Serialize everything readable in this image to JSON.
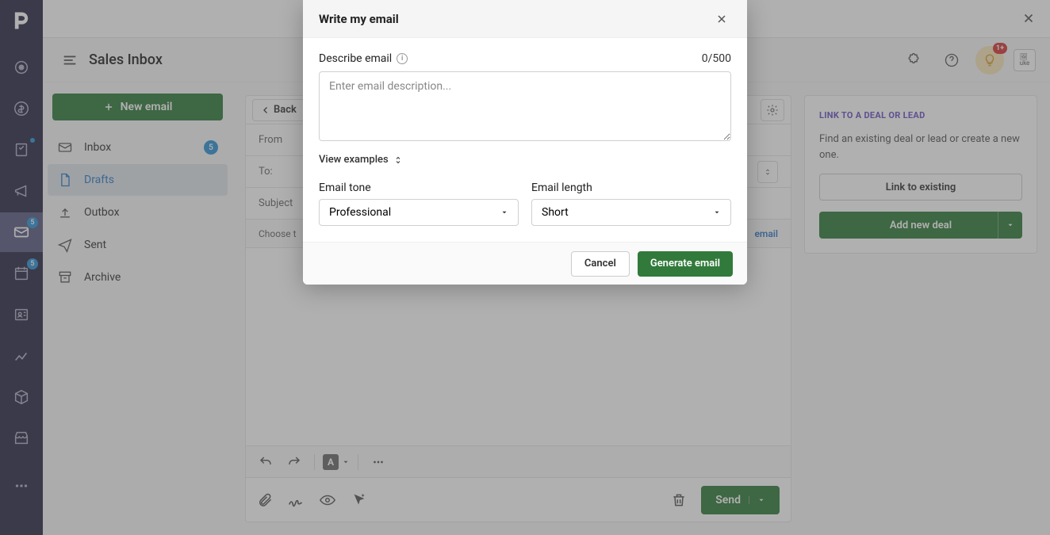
{
  "rail": {
    "badges": {
      "mail": "5",
      "calendar": "5"
    }
  },
  "header": {
    "title": "Sales Inbox",
    "bulb_badge": "1+",
    "avatar_alt": "uke"
  },
  "sidebar": {
    "new_email": "New email",
    "folders": [
      {
        "icon": "inbox",
        "label": "Inbox",
        "count": "5"
      },
      {
        "icon": "draft",
        "label": "Drafts"
      },
      {
        "icon": "outbox",
        "label": "Outbox"
      },
      {
        "icon": "sent",
        "label": "Sent"
      },
      {
        "icon": "archive",
        "label": "Archive"
      }
    ]
  },
  "compose": {
    "back": "Back",
    "from": "From",
    "to": "To:",
    "subject": "Subject",
    "choose_prefix": "Choose t",
    "write_my_email_link": "email",
    "send": "Send"
  },
  "right_panel": {
    "title": "LINK TO A DEAL OR LEAD",
    "desc": "Find an existing deal or lead or create a new one.",
    "link_btn": "Link to existing",
    "add_btn": "Add new deal"
  },
  "modal": {
    "title": "Write my email",
    "describe_label": "Describe email",
    "counter": "0/500",
    "placeholder": "Enter email description...",
    "view_examples": "View examples",
    "tone_label": "Email tone",
    "tone_value": "Professional",
    "length_label": "Email length",
    "length_value": "Short",
    "cancel": "Cancel",
    "generate": "Generate email"
  }
}
